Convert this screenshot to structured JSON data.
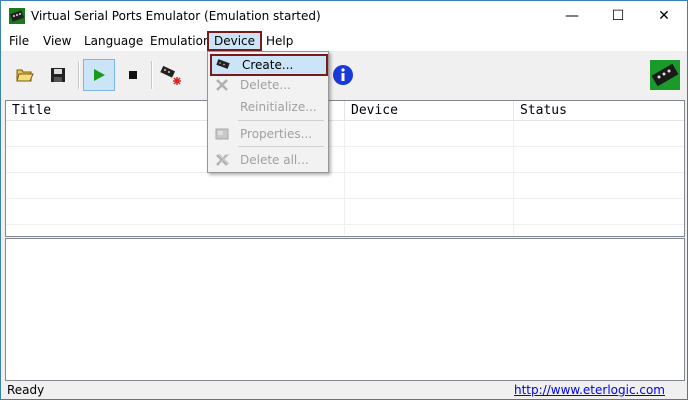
{
  "window": {
    "title": "Virtual Serial Ports Emulator (Emulation started)"
  },
  "window_controls": {
    "minimize": "—",
    "maximize": "☐",
    "close": "✕"
  },
  "menu": {
    "items": [
      {
        "label": "File"
      },
      {
        "label": "View"
      },
      {
        "label": "Language"
      },
      {
        "label": "Emulation"
      },
      {
        "label": "Device",
        "active": true
      },
      {
        "label": "Help"
      }
    ]
  },
  "toolbar": {
    "buttons": [
      {
        "name": "open",
        "icon": "open-folder-icon"
      },
      {
        "name": "save",
        "icon": "floppy-disk-icon"
      },
      {
        "name": "start",
        "icon": "play-icon",
        "pressed": true
      },
      {
        "name": "stop",
        "icon": "stop-icon"
      },
      {
        "name": "create-device",
        "icon": "new-device-icon"
      },
      {
        "name": "about",
        "icon": "info-icon"
      },
      {
        "name": "logo",
        "icon": "app-logo-icon"
      }
    ]
  },
  "device_menu": {
    "items": [
      {
        "label": "Create...",
        "enabled": true,
        "highlighted": true
      },
      {
        "label": "Delete...",
        "enabled": false
      },
      {
        "label": "Reinitialize...",
        "enabled": false
      },
      {
        "label": "Properties...",
        "enabled": false
      },
      {
        "label": "Delete all...",
        "enabled": false
      }
    ]
  },
  "grid": {
    "columns": [
      "Title",
      "Device",
      "Status"
    ],
    "rows": []
  },
  "status": {
    "text": "Ready",
    "link": "http://www.eterlogic.com"
  },
  "colors": {
    "highlight_border": "#7b1a1a",
    "selection": "#cce4f7",
    "link": "#0000ee",
    "play_green": "#1a9a1a"
  }
}
